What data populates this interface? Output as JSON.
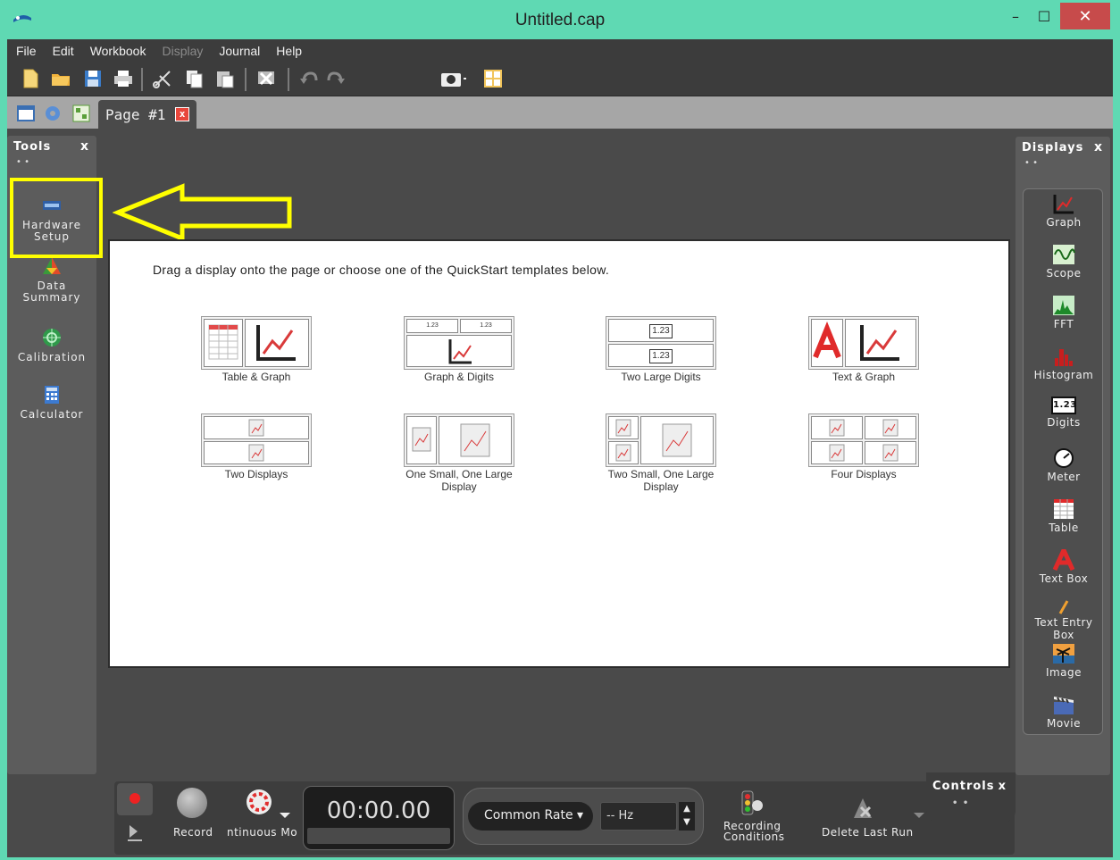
{
  "window": {
    "title": "Untitled.cap",
    "min": "–",
    "max": "☐",
    "close": "✕"
  },
  "menu": [
    {
      "label": "File",
      "enabled": true
    },
    {
      "label": "Edit",
      "enabled": true
    },
    {
      "label": "Workbook",
      "enabled": true
    },
    {
      "label": "Display",
      "enabled": false
    },
    {
      "label": "Journal",
      "enabled": true
    },
    {
      "label": "Help",
      "enabled": true
    }
  ],
  "tab": {
    "label": "Page #1",
    "close": "x"
  },
  "tools": {
    "title": "Tools",
    "close": "x",
    "dots": "• •",
    "items": [
      {
        "label1": "Hardware",
        "label2": "Setup"
      },
      {
        "label1": "Data",
        "label2": "Summary"
      },
      {
        "label1": "Calibration",
        "label2": ""
      },
      {
        "label1": "Calculator",
        "label2": ""
      }
    ]
  },
  "canvas": {
    "instruction": "Drag a display onto the page or choose one of the QuickStart templates below.",
    "templates": [
      {
        "label": "Table & Graph"
      },
      {
        "label": "Graph & Digits"
      },
      {
        "label": "Two Large Digits"
      },
      {
        "label": "Text & Graph"
      },
      {
        "label": "Two Displays"
      },
      {
        "label": "One Small, One Large Display"
      },
      {
        "label": "Two Small, One Large Display"
      },
      {
        "label": "Four Displays"
      }
    ],
    "digits_value": "1.23"
  },
  "displays": {
    "title": "Displays",
    "close": "x",
    "dots": "• •",
    "items": [
      "Graph",
      "Scope",
      "FFT",
      "Histogram",
      "Digits",
      "Meter",
      "Table",
      "Text Box",
      "Text Entry Box",
      "Image",
      "Movie"
    ],
    "digits_icon_text": "1.23"
  },
  "controls": {
    "title": "Controls",
    "close": "x",
    "dots": "• •",
    "record_label": "Record",
    "mode_label": "ntinuous Mo",
    "timer": "00:00.00",
    "rate_label": "Common Rate ▾",
    "hz_value": "-- Hz",
    "recording_conditions_1": "Recording",
    "recording_conditions_2": "Conditions",
    "delete_last_run": "Delete Last Run"
  },
  "colors": {
    "titlebar": "#5fd9b3",
    "highlight": "#ffff00",
    "close": "#c74b4b",
    "accent_red": "#e22"
  }
}
